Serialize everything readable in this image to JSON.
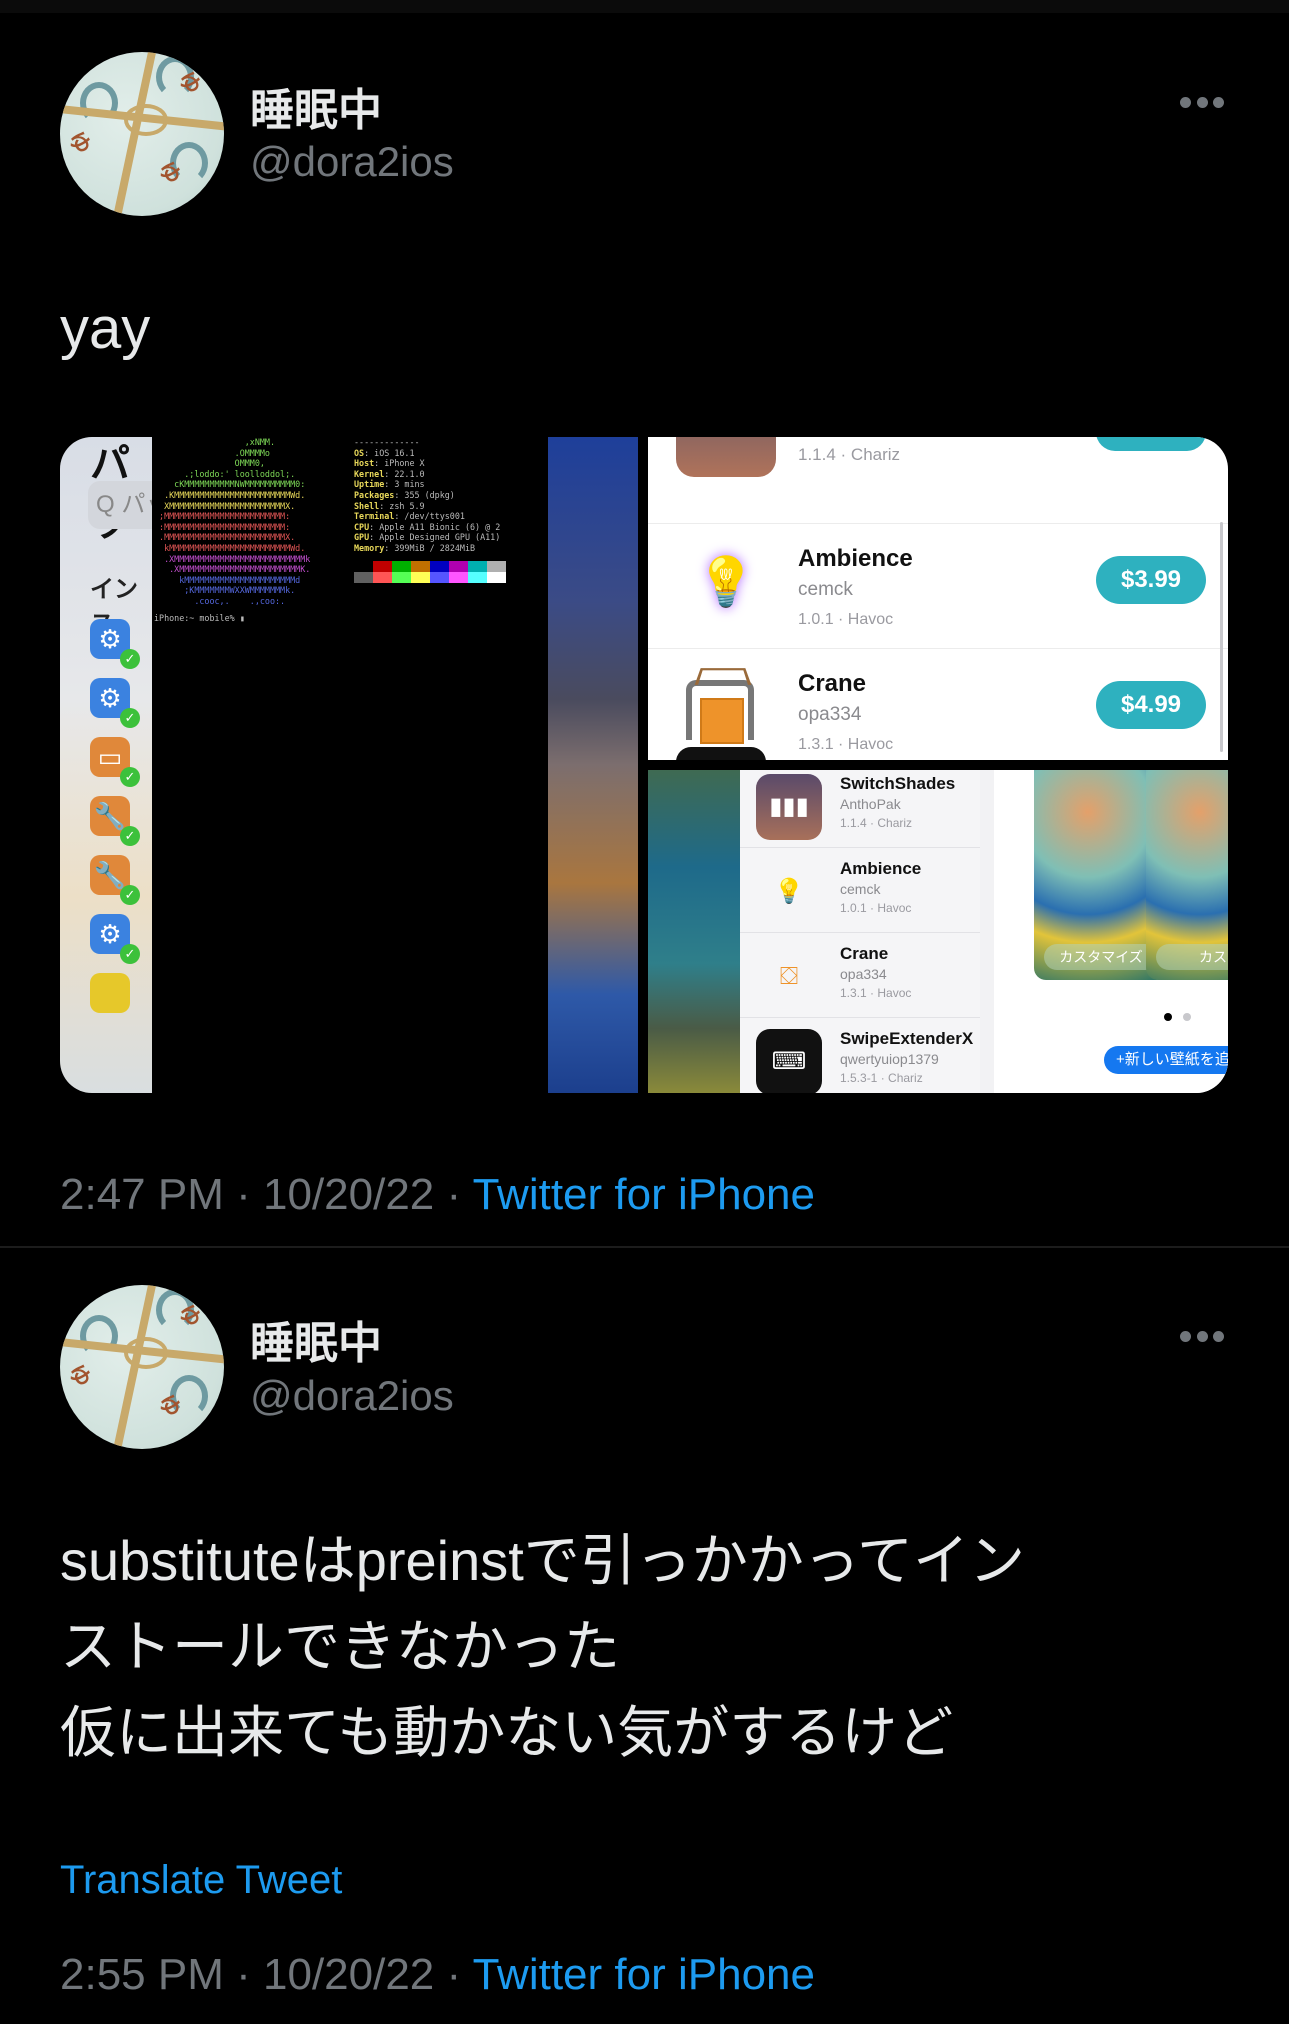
{
  "tweets": [
    {
      "display_name": "睡眠中",
      "handle": "@dora2ios",
      "text": "yay",
      "time": "2:47 PM",
      "date": "10/20/22",
      "separator": "·",
      "source": "Twitter for iPhone",
      "media": {
        "left": {
          "package_panel": {
            "title": "パッ",
            "search_placeholder": "Q パッ",
            "section": "インス",
            "icons": [
              {
                "icon": "gear-icon",
                "color": "#3b82e0",
                "glyph": "⚙",
                "installed": true
              },
              {
                "icon": "gear-icon",
                "color": "#3b82e0",
                "glyph": "⚙",
                "installed": true
              },
              {
                "icon": "folder-icon",
                "color": "#e0883a",
                "glyph": "▭",
                "installed": true
              },
              {
                "icon": "wrench-icon",
                "color": "#e0883a",
                "glyph": "🔧",
                "installed": true
              },
              {
                "icon": "wrench-icon",
                "color": "#e0883a",
                "glyph": "🔧",
                "installed": true
              },
              {
                "icon": "gear-icon",
                "color": "#3b82e0",
                "glyph": "⚙",
                "installed": true
              },
              {
                "icon": "app-icon",
                "color": "#e6c82a",
                "glyph": "",
                "installed": false
              }
            ]
          },
          "terminal": {
            "logo_lines": [
              {
                "text": "                  ,xNMM.",
                "color": "#7ed957"
              },
              {
                "text": "                .OMMMMo",
                "color": "#7ed957"
              },
              {
                "text": "                OMMM0,",
                "color": "#7ed957"
              },
              {
                "text": "      .;loddo:' loolloddol;.",
                "color": "#7ed957"
              },
              {
                "text": "    cKMMMMMMMMMMNWMMMMMMMMMM0:",
                "color": "#7ed957"
              },
              {
                "text": "  .KMMMMMMMMMMMMMMMMMMMMMMMWd.",
                "color": "#e8d85a"
              },
              {
                "text": "  XMMMMMMMMMMMMMMMMMMMMMMMX.",
                "color": "#e8d85a"
              },
              {
                "text": " ;MMMMMMMMMMMMMMMMMMMMMMMM:",
                "color": "#e05555"
              },
              {
                "text": " :MMMMMMMMMMMMMMMMMMMMMMMM:",
                "color": "#e05555"
              },
              {
                "text": " .MMMMMMMMMMMMMMMMMMMMMMMMX.",
                "color": "#e05555"
              },
              {
                "text": "  kMMMMMMMMMMMMMMMMMMMMMMMMWd.",
                "color": "#e05555"
              },
              {
                "text": "  .XMMMMMMMMMMMMMMMMMMMMMMMMMMk",
                "color": "#c44fd0"
              },
              {
                "text": "   .XMMMMMMMMMMMMMMMMMMMMMMMMK.",
                "color": "#c44fd0"
              },
              {
                "text": "     kMMMMMMMMMMMMMMMMMMMMMMd",
                "color": "#5568e0"
              },
              {
                "text": "      ;KMMMMMMMWXXWMMMMMMMk.",
                "color": "#5568e0"
              },
              {
                "text": "        .cooc,.    .,coo:.",
                "color": "#5568e0"
              }
            ],
            "info": [
              {
                "key": "",
                "value": "-------------"
              },
              {
                "key": "OS",
                "value": "iOS 16.1"
              },
              {
                "key": "Host",
                "value": "iPhone X"
              },
              {
                "key": "Kernel",
                "value": "22.1.0"
              },
              {
                "key": "Uptime",
                "value": "3 mins"
              },
              {
                "key": "Packages",
                "value": "355 (dpkg)"
              },
              {
                "key": "Shell",
                "value": "zsh 5.9"
              },
              {
                "key": "Terminal",
                "value": "/dev/ttys001"
              },
              {
                "key": "CPU",
                "value": "Apple A11 Bionic (6) @ 2"
              },
              {
                "key": "GPU",
                "value": "Apple Designed GPU (A11)"
              },
              {
                "key": "Memory",
                "value": "399MiB / 2824MiB"
              }
            ],
            "palette": [
              "#000000",
              "#c00000",
              "#00b000",
              "#c07000",
              "#0000c0",
              "#b000b0",
              "#00b0b0",
              "#b0b0b0",
              "#606060",
              "#ff5555",
              "#55ff55",
              "#ffff55",
              "#5555ff",
              "#ff55ff",
              "#55ffff",
              "#ffffff"
            ],
            "prompt": "iPhone:~ mobile% ▮"
          }
        },
        "top_right": {
          "rows": [
            {
              "name": "",
              "author": "",
              "version": "1.1.4 · Chariz",
              "price": "",
              "icon": "switchshades-icon"
            },
            {
              "name": "Ambience",
              "author": "cemck",
              "version": "1.0.1 · Havoc",
              "price": "$3.99",
              "icon": "lightbulb-icon"
            },
            {
              "name": "Crane",
              "author": "opa334",
              "version": "1.3.1 · Havoc",
              "price": "$4.99",
              "icon": "crane-icon"
            }
          ]
        },
        "bottom_right": {
          "rows": [
            {
              "name": "SwitchShades",
              "author": "AnthoPak",
              "version": "1.1.4 · Chariz",
              "icon": "switchshades-icon"
            },
            {
              "name": "Ambience",
              "author": "cemck",
              "version": "1.0.1 · Havoc",
              "icon": "lightbulb-icon"
            },
            {
              "name": "Crane",
              "author": "opa334",
              "version": "1.3.1 · Havoc",
              "icon": "crane-icon"
            },
            {
              "name": "SwipeExtenderX",
              "author": "qwertyuiop1379",
              "version": "1.5.3-1 · Chariz",
              "icon": "keyboard-crown-icon"
            }
          ],
          "wallpaper": {
            "customize_label": "カスタマイズ",
            "customize_label_2": "カス",
            "add_wallpaper_label": "+新しい壁紙を追",
            "page_count": 2,
            "current_page": 1
          }
        }
      }
    },
    {
      "display_name": "睡眠中",
      "handle": "@dora2ios",
      "text_lines": [
        "substituteはpreinstで引っかかってイン",
        "ストールできなかった",
        "仮に出来ても動かない気がするけど"
      ],
      "translate_label": "Translate Tweet",
      "time": "2:55 PM",
      "date": "10/20/22",
      "separator": "·",
      "source": "Twitter for iPhone"
    }
  ],
  "colors": {
    "background": "#000000",
    "text": "#e7e9ea",
    "secondary": "#71767b",
    "link": "#1d9bf0",
    "price_button": "#2eb1bf"
  }
}
